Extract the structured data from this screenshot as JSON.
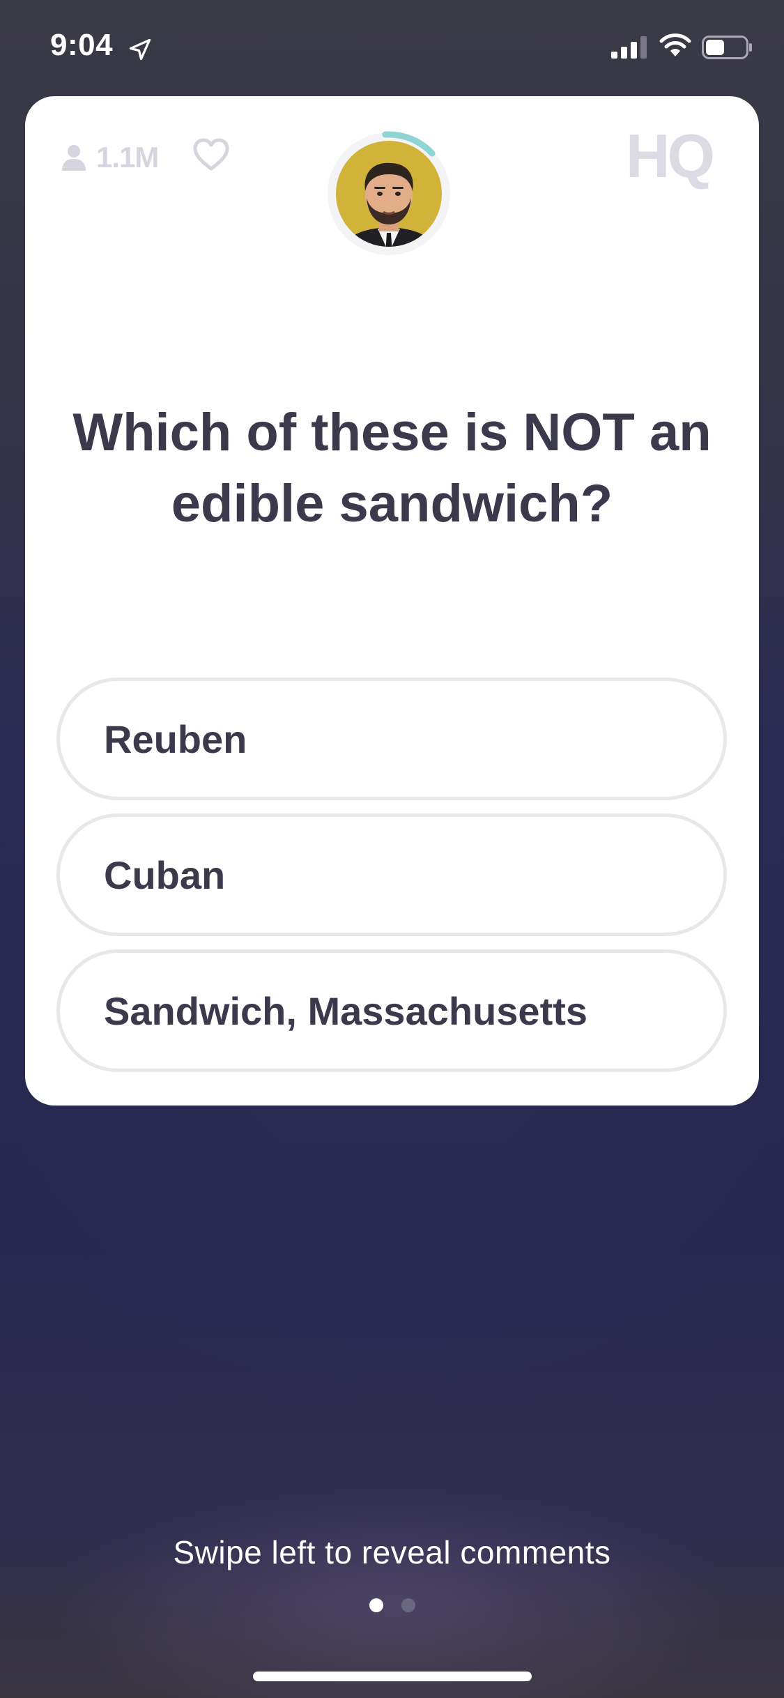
{
  "status_bar": {
    "time": "9:04",
    "icons": [
      "location-arrow-icon",
      "cellular-signal-icon",
      "wifi-icon",
      "battery-icon"
    ]
  },
  "header": {
    "viewer_count": "1.1M",
    "viewer_icon": "person-icon",
    "like_icon": "heart-icon",
    "logo": "HQ",
    "host_ring_color": "#8fd4d4"
  },
  "question": {
    "text": "Which of these is NOT an edible sandwich?"
  },
  "answers": [
    {
      "label": "Reuben"
    },
    {
      "label": "Cuban"
    },
    {
      "label": "Sandwich, Massachusetts"
    }
  ],
  "footer": {
    "hint": "Swipe left to reveal comments",
    "pages": 2,
    "current_page": 1
  },
  "colors": {
    "text_dark": "#3b3a4d",
    "muted_icon": "#d6d5df",
    "answer_border": "#e8e8ea"
  }
}
